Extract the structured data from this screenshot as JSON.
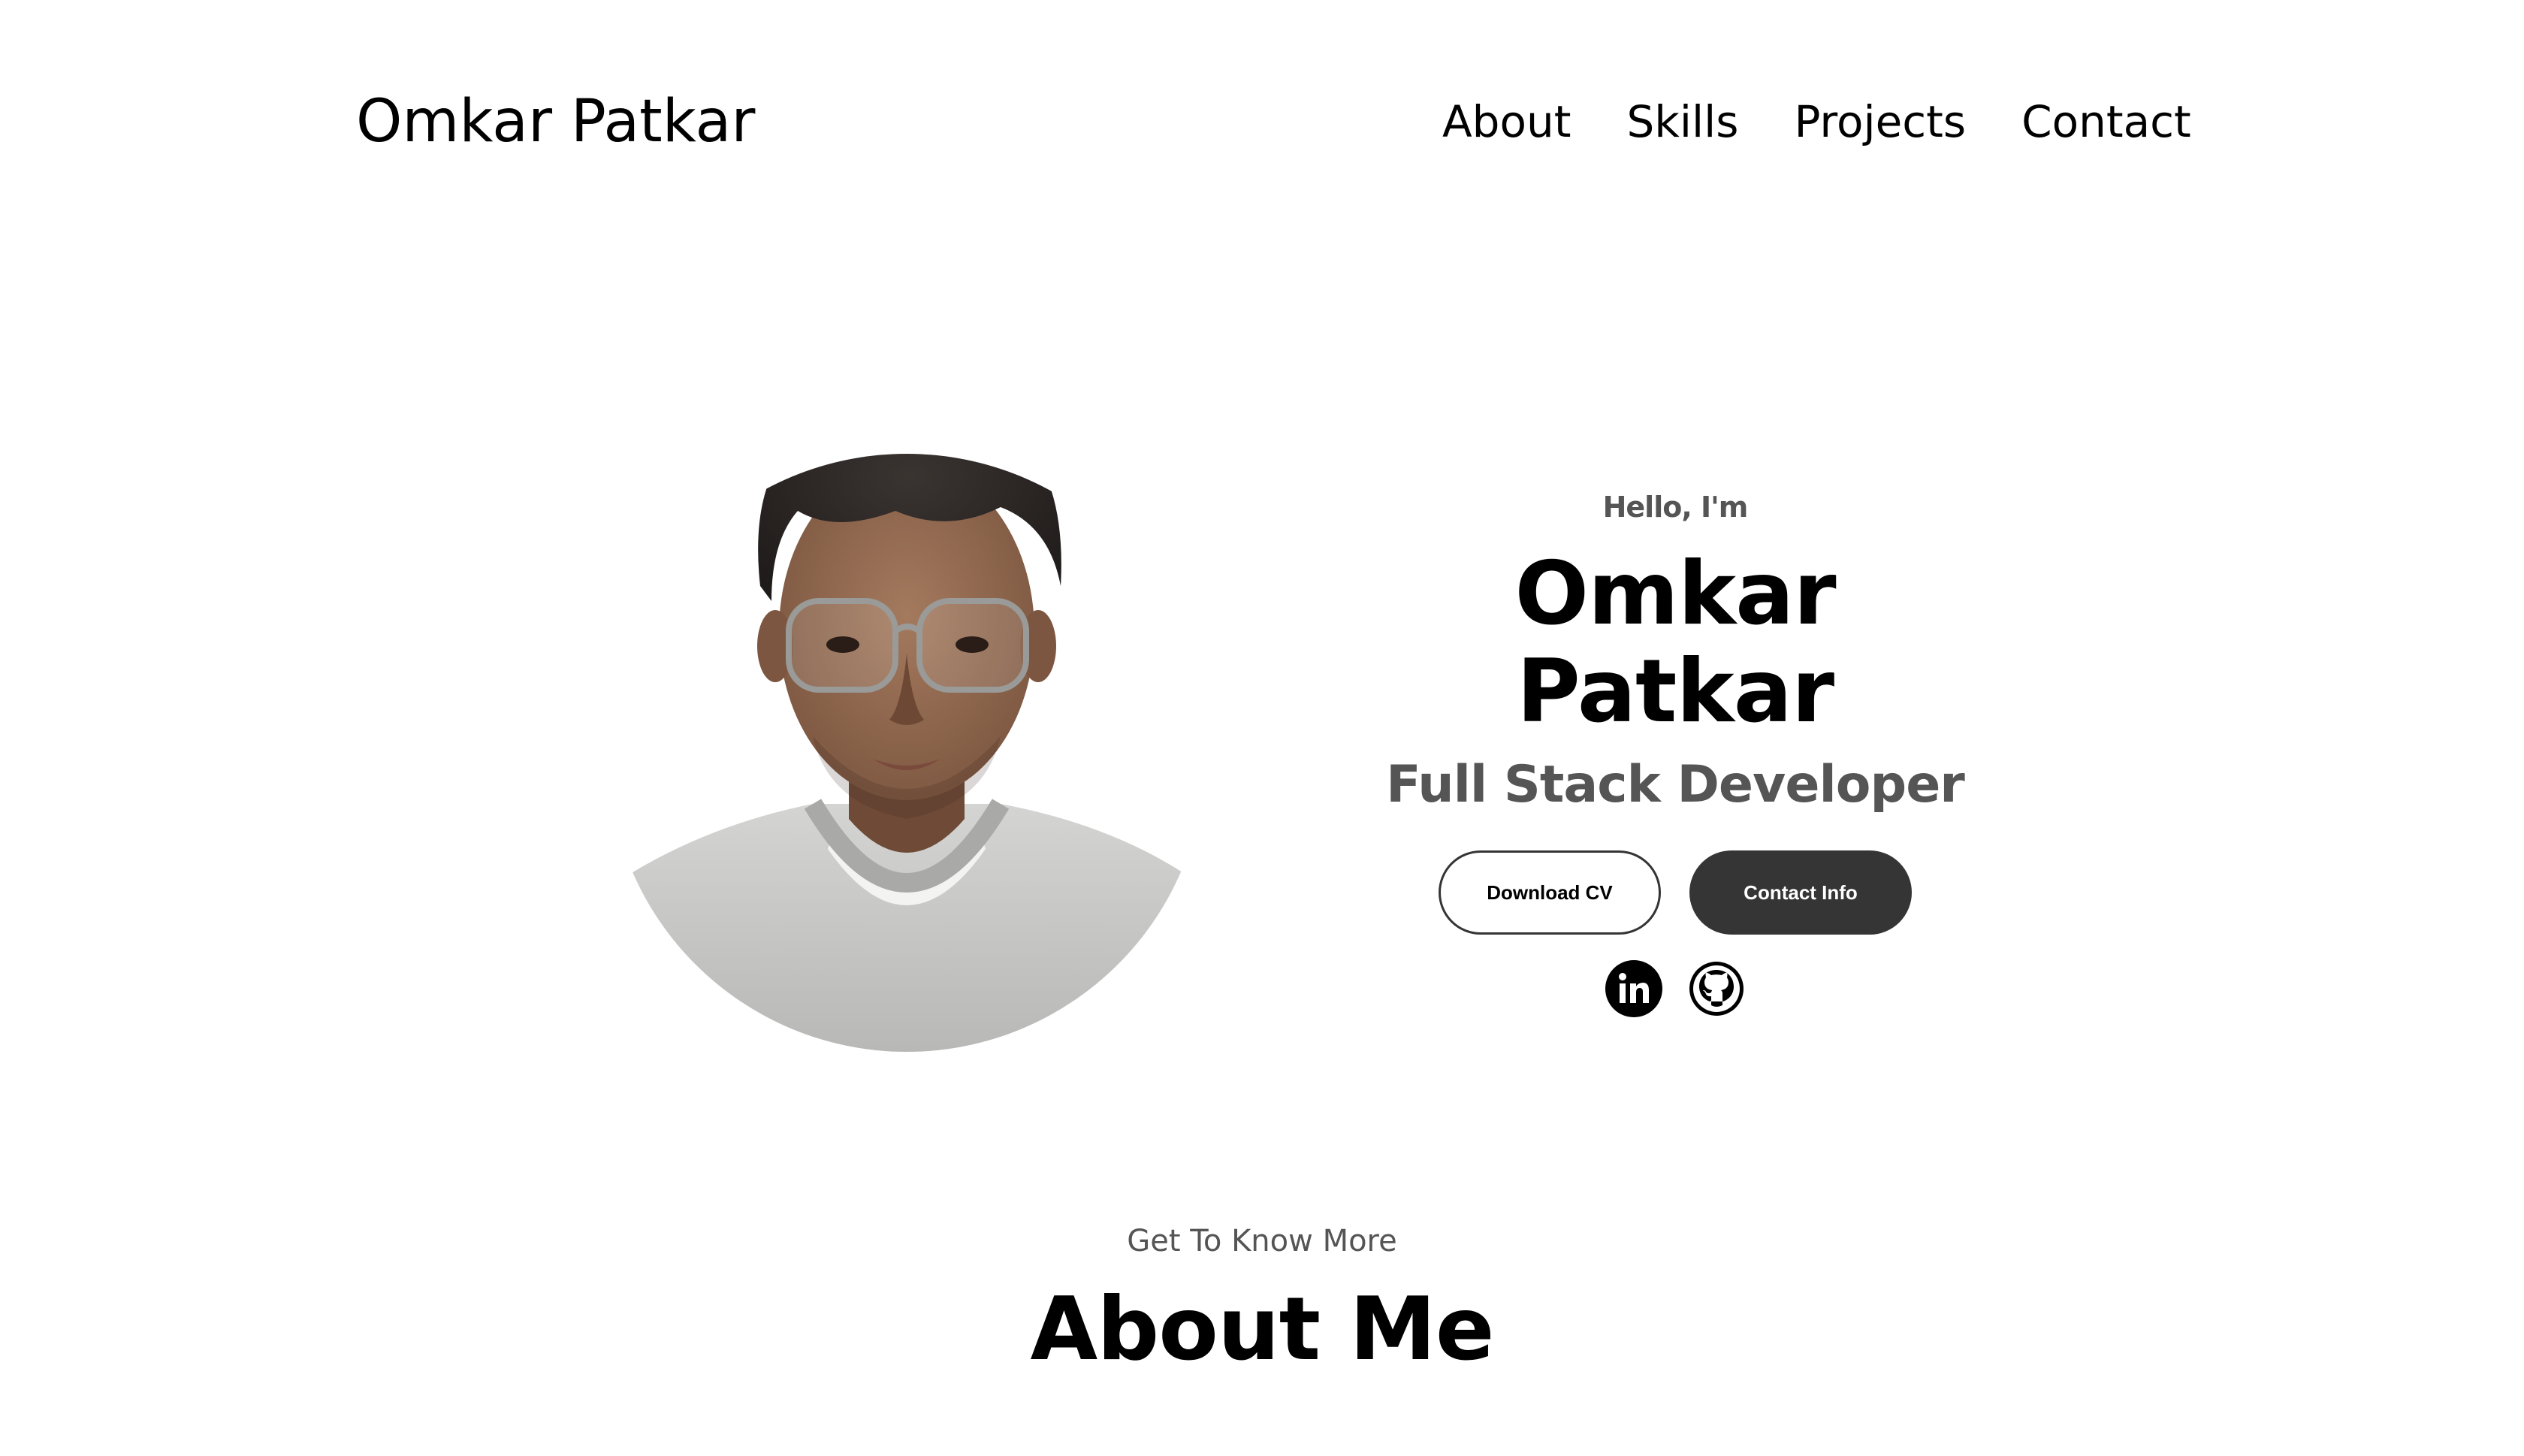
{
  "nav": {
    "logo": "Omkar Patkar",
    "links": [
      "About",
      "Skills",
      "Projects",
      "Contact"
    ]
  },
  "hero": {
    "greeting": "Hello, I'm",
    "name": "Omkar Patkar",
    "title": "Full Stack Developer",
    "buttons": {
      "download_cv": "Download CV",
      "contact_info": "Contact Info"
    },
    "social_icons": [
      "linkedin-icon",
      "github-icon"
    ]
  },
  "about": {
    "subtitle": "Get To Know More",
    "title": "About Me"
  },
  "colors": {
    "text": "#000000",
    "muted": "#555555",
    "button_dark": "#353535",
    "background": "#ffffff"
  }
}
